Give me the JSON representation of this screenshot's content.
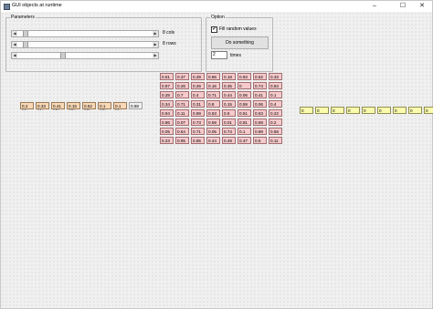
{
  "window": {
    "title": "GUI objects at runtime",
    "minimize_glyph": "–",
    "maximize_glyph": "☐",
    "close_glyph": "✕"
  },
  "parameters": {
    "title": "Parameters",
    "sliders": [
      {
        "label": "8 cols",
        "value": 8
      },
      {
        "label": "8 rows",
        "value": 8
      },
      {
        "label": "",
        "value": 50
      }
    ]
  },
  "option": {
    "title": "Option",
    "checkbox_label": "Fill random values",
    "checkbox_checked": true,
    "checkbox_glyph": "✔",
    "button_label": "Do something",
    "times_value": "2",
    "times_label": "times"
  },
  "row_cells": [
    {
      "value": "0.2",
      "sub": "0.9..."
    },
    {
      "value": "0.33",
      "sub": "0.3..."
    },
    {
      "value": "0.41",
      "sub": "0.32..."
    },
    {
      "value": "0.15",
      "sub": "0.22..."
    },
    {
      "value": "0.62",
      "sub": "0.22..."
    },
    {
      "value": "0.1",
      "sub": "0.42..."
    },
    {
      "value": "0.1",
      "sub": "0.4..."
    },
    {
      "value": "0.88",
      "sub": ""
    }
  ],
  "grid": [
    [
      "0.61",
      "0.37",
      "0.39",
      "0.86",
      "0.18",
      "0.93",
      "0.52",
      "0.33"
    ],
    [
      "0.87",
      "0.26",
      "0.26",
      "0.16",
      "0.35",
      "0",
      "0.74",
      "0.84"
    ],
    [
      "0.28",
      "0.7",
      "0.4",
      "0.71",
      "0.44",
      "0.06",
      "0.41",
      "0.1"
    ],
    [
      "0.34",
      "0.71",
      "0.31",
      "0.8",
      "0.15",
      "0.59",
      "0.06",
      "0.4"
    ],
    [
      "0.94",
      "0.11",
      "0.89",
      "0.63",
      "0.6",
      "0.51",
      "0.63",
      "0.22"
    ],
    [
      "0.86",
      "0.07",
      "0.73",
      "0.59",
      "0.01",
      "0.91",
      "0.69",
      "0.2"
    ],
    [
      "0.05",
      "0.64",
      "0.71",
      "0.05",
      "0.74",
      "0.1",
      "0.89",
      "0.58"
    ],
    [
      "0.23",
      "0.95",
      "0.85",
      "0.44",
      "0.49",
      "0.47",
      "0.6",
      "0.11"
    ]
  ],
  "zero_cells": [
    "0",
    "0",
    "0",
    "0",
    "0",
    "0",
    "0",
    "0",
    "0"
  ]
}
